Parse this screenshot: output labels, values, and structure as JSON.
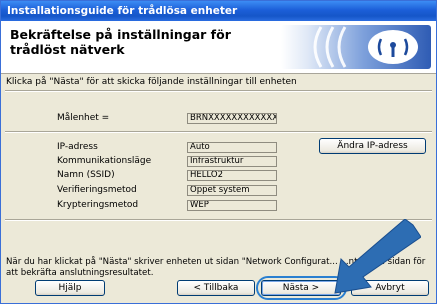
{
  "window": {
    "title": "Installationsguide för trådlösa enheter"
  },
  "header": {
    "title": "Bekräftelse på inställningar för trådlöst nätverk"
  },
  "instruction": "Klicka på \"Nästa\" för att skicka följande inställningar till enheten",
  "target": {
    "label": "Målenhet =",
    "value": "BRNXXXXXXXXXXXX"
  },
  "settings": [
    {
      "label": "IP-adress",
      "value": "Auto"
    },
    {
      "label": "Kommunikationsläge",
      "value": "Infrastruktur"
    },
    {
      "label": "Namn (SSID)",
      "value": "HELLO2"
    },
    {
      "label": "Verifieringsmetod",
      "value": "Öppet system"
    },
    {
      "label": "Krypteringsmetod",
      "value": "WEP"
    }
  ],
  "change_ip_button": "Ändra IP-adress",
  "footer_text": "När du har klickat på \"Nästa\" skriver enheten ut sidan \"Network Configurat... ...ntrollera sidan för att bekräfta anslutningsresultatet.",
  "buttons": {
    "help": "Hjälp",
    "back": "< Tillbaka",
    "next": "Nästa >",
    "cancel": "Avbryt"
  },
  "colors": {
    "titlebar": "#1c5fd8",
    "highlight": "#2a7fd0",
    "arrow": "#2d6db3"
  },
  "icons": {
    "banner": "wireless-signal-icon",
    "pointer": "pointer-arrow-icon"
  }
}
